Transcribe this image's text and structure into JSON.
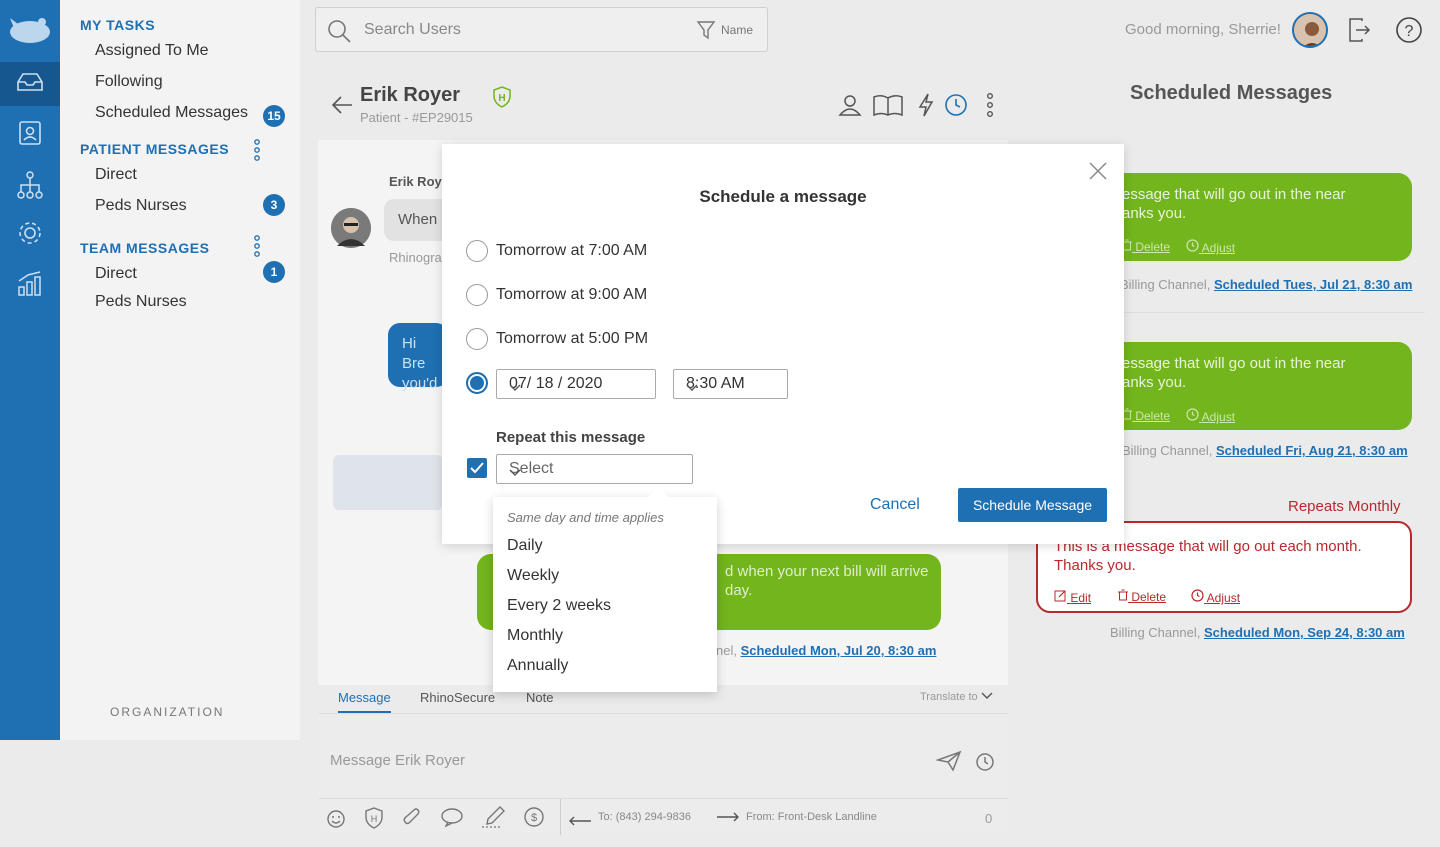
{
  "sidebar": {
    "my_tasks_title": "MY TASKS",
    "my_tasks": [
      {
        "label": "Assigned To Me"
      },
      {
        "label": "Following"
      },
      {
        "label": "Scheduled Messages",
        "badge": "15"
      }
    ],
    "patient_messages_title": "PATIENT MESSAGES",
    "patient_messages": [
      {
        "label": "Direct"
      },
      {
        "label": "Peds Nurses",
        "badge": "3"
      }
    ],
    "team_messages_title": "TEAM MESSAGES",
    "team_messages": [
      {
        "label": "Direct",
        "badge": "1"
      },
      {
        "label": "Peds Nurses"
      }
    ],
    "organization_label": "ORGANIZATION"
  },
  "topbar": {
    "search_placeholder": "Search Users",
    "filter_label": "Name",
    "greeting": "Good morning, Sherrie!"
  },
  "conversation": {
    "patient_name": "Erik Royer",
    "patient_id": "Patient - #EP29015",
    "sender_name": "Erik Roye",
    "incoming_text": "When",
    "rhino_label": "Rhinogra",
    "outgoing_blue_text": "Hi Bre you'd",
    "green_text_1": "d when your next bill will arrive",
    "green_text_2": "day.",
    "sched_prefix": "nel,",
    "sched_link": "Scheduled Mon, Jul 20, 8:30 am"
  },
  "composer": {
    "tabs": [
      "Message",
      "RhinoSecure",
      "Note"
    ],
    "translate_label": "Translate to",
    "placeholder": "Message Erik Royer",
    "to_label": "To: (843) 294-9836",
    "from_label": "From: Front-Desk Landline",
    "char_count": "0"
  },
  "right_panel": {
    "title": "Scheduled Messages",
    "cards": [
      {
        "text_1": "essage that will go out in the near",
        "text_2": "anks you.",
        "delete": "Delete",
        "adjust": "Adjust",
        "meta_prefix": "Billing Channel,",
        "meta_link": "Scheduled Tues, Jul 21, 8:30 am"
      },
      {
        "text_1": "essage that will go out in the near",
        "text_2": "anks you.",
        "delete": "Delete",
        "adjust": "Adjust",
        "meta_prefix": "Billing Channel,",
        "meta_link": "Scheduled Fri, Aug 21, 8:30 am"
      }
    ],
    "repeats_label": "Repeats Monthly",
    "red_card": {
      "text_1": "This is a message that will go out each month.",
      "text_2": "Thanks you.",
      "edit": "Edit",
      "delete": "Delete",
      "adjust": "Adjust",
      "meta_prefix": "Billing Channel,",
      "meta_link": "Scheduled Mon, Sep 24, 8:30 am"
    }
  },
  "modal": {
    "title": "Schedule a message",
    "options": [
      {
        "label": "Tomorrow at 7:00 AM",
        "checked": false
      },
      {
        "label": "Tomorrow at 9:00 AM",
        "checked": false
      },
      {
        "label": "Tomorrow at 5:00 PM",
        "checked": false
      }
    ],
    "custom_date": "07/ 18 / 2020",
    "custom_time": "8:30 AM",
    "repeat_label": "Repeat this message",
    "repeat_checked": true,
    "repeat_select": "Select",
    "cancel_label": "Cancel",
    "schedule_label": "Schedule Message"
  },
  "repeat_dropdown": {
    "hint": "Same day and time applies",
    "options": [
      "Daily",
      "Weekly",
      "Every 2 weeks",
      "Monthly",
      "Annually"
    ]
  },
  "colors": {
    "primary": "#1f6fb3",
    "green": "#72b51c",
    "red": "#b7292d"
  }
}
